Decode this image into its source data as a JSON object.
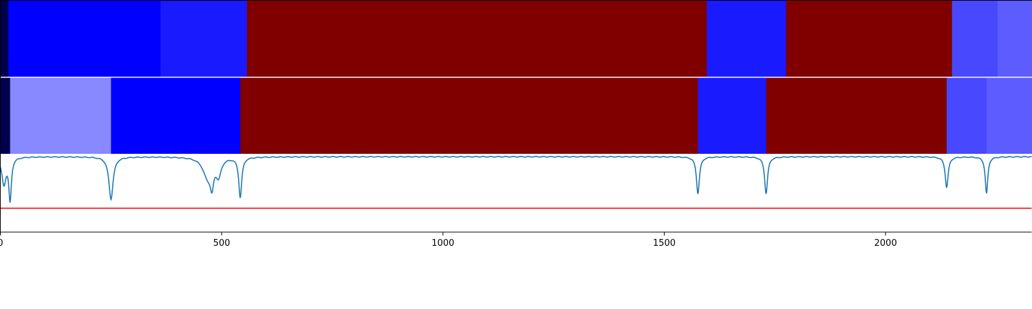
{
  "chart_data": {
    "type": "heatmap",
    "xlim": [
      0,
      2330
    ],
    "xticks": [
      0,
      500,
      1000,
      1500,
      2000
    ],
    "xtick_labels": [
      "0",
      "500",
      "1000",
      "1500",
      "2000"
    ],
    "rows": [
      {
        "segments": [
          {
            "start": 0,
            "end": 18,
            "color": "#00004c"
          },
          {
            "start": 18,
            "end": 362,
            "color": "#0000ff"
          },
          {
            "start": 362,
            "end": 557,
            "color": "#1a1aff"
          },
          {
            "start": 557,
            "end": 1596,
            "color": "#800000"
          },
          {
            "start": 1596,
            "end": 1775,
            "color": "#1a1aff"
          },
          {
            "start": 1775,
            "end": 2150,
            "color": "#800000"
          },
          {
            "start": 2150,
            "end": 2253,
            "color": "#4848ff"
          },
          {
            "start": 2253,
            "end": 2330,
            "color": "#5c5cff"
          }
        ]
      },
      {
        "segments": [
          {
            "start": 0,
            "end": 22,
            "color": "#00004c"
          },
          {
            "start": 22,
            "end": 250,
            "color": "#8888ff"
          },
          {
            "start": 250,
            "end": 542,
            "color": "#0000ff"
          },
          {
            "start": 542,
            "end": 1576,
            "color": "#800000"
          },
          {
            "start": 1576,
            "end": 1730,
            "color": "#1a1aff"
          },
          {
            "start": 1730,
            "end": 2138,
            "color": "#800000"
          },
          {
            "start": 2138,
            "end": 2228,
            "color": "#4848ff"
          },
          {
            "start": 2228,
            "end": 2330,
            "color": "#5c5cff"
          }
        ]
      }
    ],
    "line_series": {
      "color": "#1f77b4",
      "ylim": [
        0,
        1
      ],
      "baseline": 0.98,
      "dips": [
        {
          "center": 8,
          "depth": 0.35,
          "width": 10
        },
        {
          "center": 22,
          "depth": 0.55,
          "width": 6
        },
        {
          "center": 250,
          "depth": 0.55,
          "width": 10
        },
        {
          "center": 468,
          "depth": 0.25,
          "width": 22
        },
        {
          "center": 478,
          "depth": 0.28,
          "width": 8
        },
        {
          "center": 493,
          "depth": 0.22,
          "width": 12
        },
        {
          "center": 542,
          "depth": 0.52,
          "width": 7
        },
        {
          "center": 1576,
          "depth": 0.48,
          "width": 7
        },
        {
          "center": 1730,
          "depth": 0.48,
          "width": 7
        },
        {
          "center": 2138,
          "depth": 0.4,
          "width": 7
        },
        {
          "center": 2228,
          "depth": 0.48,
          "width": 6
        }
      ]
    },
    "threshold": {
      "value": 0.31,
      "color": "#ff0000"
    }
  }
}
